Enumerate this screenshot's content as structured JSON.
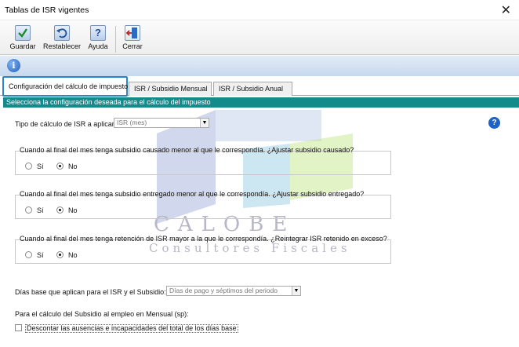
{
  "window": {
    "title": "Tablas de ISR vigentes",
    "close_glyph": "✕"
  },
  "toolbar": {
    "buttons": [
      {
        "label": "Guardar",
        "icon": "check-icon"
      },
      {
        "label": "Restablecer",
        "icon": "undo-icon"
      },
      {
        "label": "Ayuda",
        "icon": "help-icon"
      },
      {
        "label": "Cerrar",
        "icon": "exit-door-icon"
      }
    ]
  },
  "info_glyph": "i",
  "tabs": [
    {
      "label": "Configuración del cálculo de impuesto",
      "active": true
    },
    {
      "label": "ISR / Subsidio Mensual",
      "active": false
    },
    {
      "label": "ISR / Subsidio Anual",
      "active": false
    }
  ],
  "banner": "Selecciona la configuración deseada para el cálculo del impuesto",
  "help_glyph": "?",
  "isr_type": {
    "label": "Tipo de cálculo de ISR a aplicar:",
    "value": "ISR (mes)"
  },
  "groups": [
    {
      "legend": "Cuando al final del mes tenga subsidio causado menor al que le correspondía. ¿Ajustar subsidio causado?",
      "options": [
        "Sí",
        "No"
      ],
      "selected": "No"
    },
    {
      "legend": "Cuando al final del mes tenga subsidio entregado menor al que le correspondía. ¿Ajustar subsidio entregado?",
      "options": [
        "Sí",
        "No"
      ],
      "selected": "No"
    },
    {
      "legend": "Cuando al final del mes tenga retención de ISR mayor a la que le correspondía. ¿Reintegrar ISR retenido en exceso?",
      "options": [
        "Sí",
        "No"
      ],
      "selected": "No"
    }
  ],
  "days_base": {
    "label": "Días base que aplican para el  ISR y el Subsidio:",
    "value": "Días de pago y séptimos del periodo"
  },
  "subsidy_title": "Para el cálculo del Subsidio al empleo en Mensual (sp):",
  "discount_checkbox": {
    "label": "Descontar las ausencias e incapacidades del total de los días base",
    "checked": false
  },
  "watermark": {
    "line1": "CALOBE",
    "line2": "Consultores Fiscales"
  },
  "colors": {
    "banner": "#148b8b",
    "tab_active_border": "#2a86c8",
    "help": "#1b62c9"
  }
}
